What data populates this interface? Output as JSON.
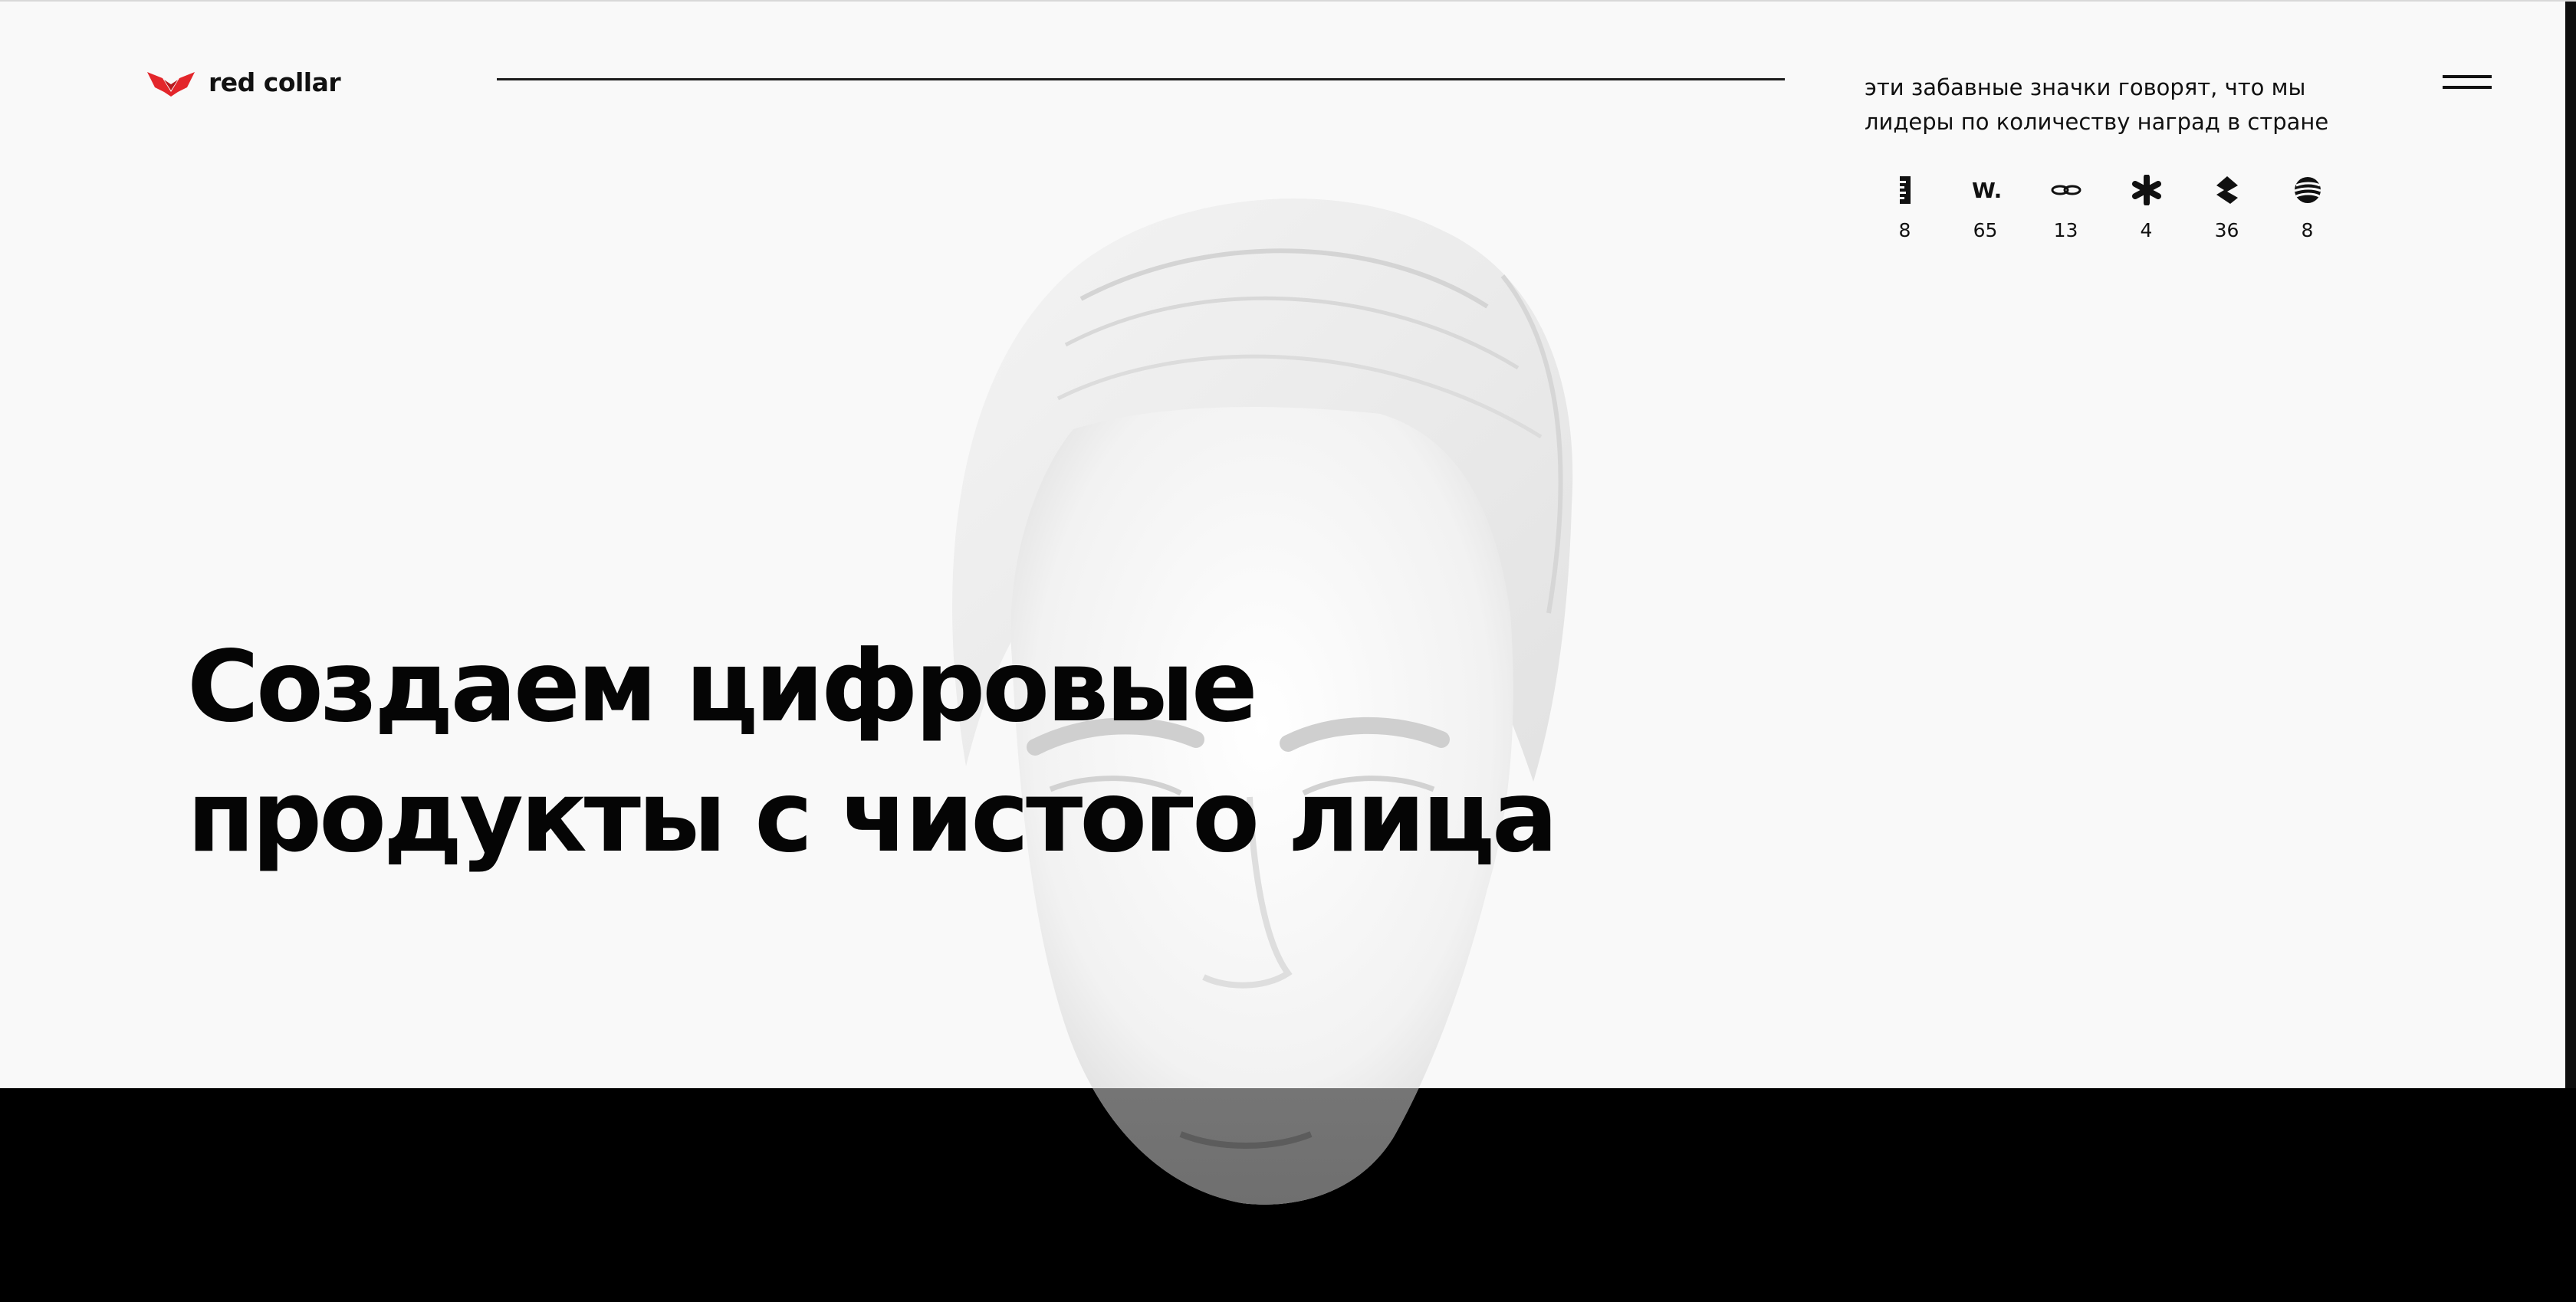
{
  "brand": {
    "name": "red collar",
    "accent_color": "#e3262b",
    "logo_icon": "collar-logo-icon"
  },
  "header": {
    "menu_icon": "hamburger-menu-icon"
  },
  "awards": {
    "caption_lines": [
      "эти забавные значки говорят, что мы",
      "лидеры по количеству наград в стране"
    ],
    "items": [
      {
        "icon": "ruler-award-icon",
        "count": "8"
      },
      {
        "icon": "w-award-icon",
        "count": "65"
      },
      {
        "icon": "chain-award-icon",
        "count": "13"
      },
      {
        "icon": "asterisk-award-icon",
        "count": "4"
      },
      {
        "icon": "s-award-icon",
        "count": "36"
      },
      {
        "icon": "sphere-award-icon",
        "count": "8"
      }
    ]
  },
  "hero": {
    "headline_lines": [
      "Создаем цифровые",
      "продукты с чистого лица"
    ],
    "background_color": "#f9f9f9",
    "footer_band_color": "#000000"
  }
}
